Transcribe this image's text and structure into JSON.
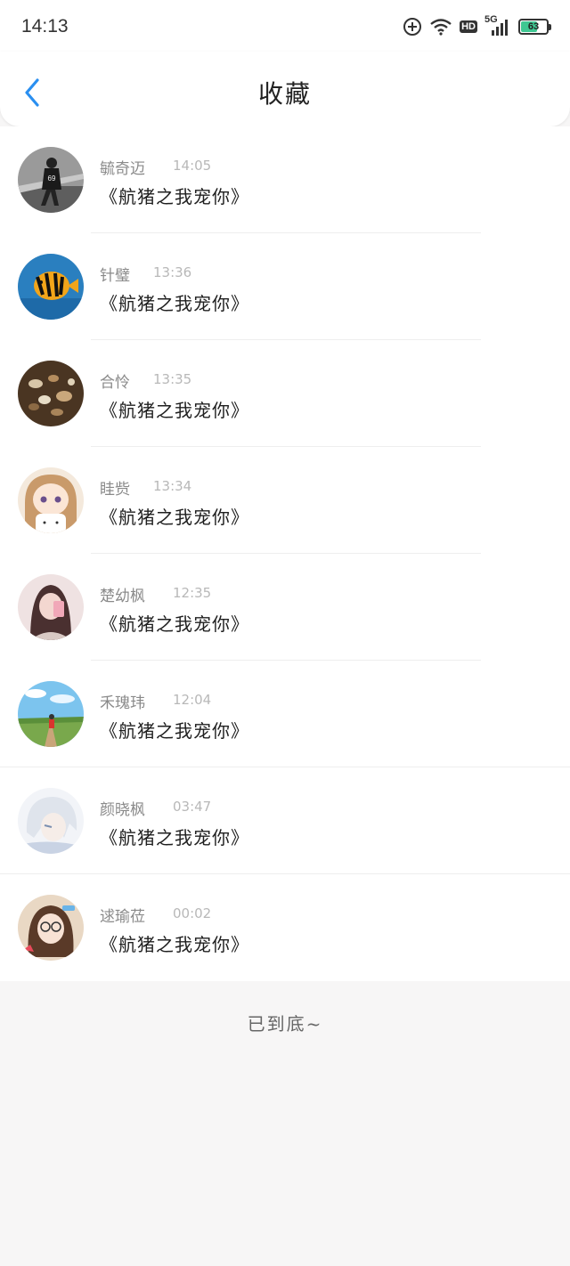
{
  "status_bar": {
    "time": "14:13",
    "network": "5G",
    "hd": "HD",
    "battery": "63",
    "battery_level": 0.63
  },
  "header": {
    "title": "收藏",
    "back_icon": "chevron-left-icon",
    "accent_color": "#2a8ff0"
  },
  "favorites": [
    {
      "name": "毓奇迈",
      "time": "14:05",
      "content": "《航猪之我宠你》",
      "avatar": "avatar-bw-person"
    },
    {
      "name": "针璧",
      "time": "13:36",
      "content": "《航猪之我宠你》",
      "avatar": "avatar-fish"
    },
    {
      "name": "合怜",
      "time": "13:35",
      "content": "《航猪之我宠你》",
      "avatar": "avatar-shells"
    },
    {
      "name": "眭赀",
      "time": "13:34",
      "content": "《航猪之我宠你》",
      "avatar": "avatar-anime-girl"
    },
    {
      "name": "楚幼枫",
      "time": "12:35",
      "content": "《航猪之我宠你》",
      "avatar": "avatar-girl-pink"
    },
    {
      "name": "禾瑰玮",
      "time": "12:04",
      "content": "《航猪之我宠你》",
      "avatar": "avatar-landscape"
    },
    {
      "name": "颜晓枫",
      "time": "03:47",
      "content": "《航猪之我宠你》",
      "avatar": "avatar-anime-white"
    },
    {
      "name": "逑瑜莅",
      "time": "00:02",
      "content": "《航猪之我宠你》",
      "avatar": "avatar-child"
    }
  ],
  "footer": {
    "end_text": "已到底~"
  }
}
